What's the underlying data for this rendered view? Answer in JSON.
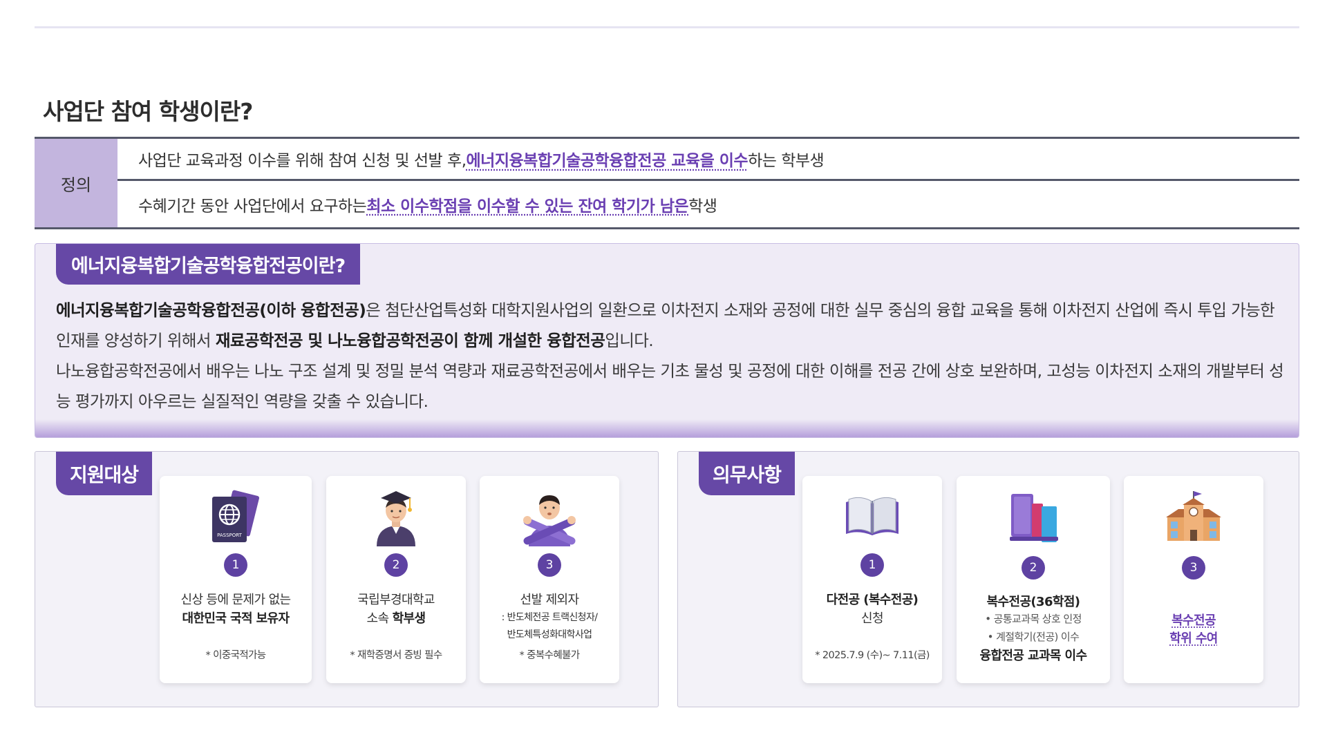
{
  "section_title": "사업단 참여 학생이란?",
  "definition": {
    "label": "정의",
    "row1": {
      "pre": "사업단 교육과정 이수를 위해 참여 신청 및 선발 후, ",
      "highlight": "에너지융복합기술공학융합전공 교육을 이수",
      "post": "하는 학부생"
    },
    "row2": {
      "pre": "수혜기간 동안 사업단에서 요구하는 ",
      "highlight": "최소 이수학점을 이수할 수 있는 잔여 학기가 남은",
      "post": " 학생"
    }
  },
  "about": {
    "tag": "에너지융복합기술공학융합전공이란?",
    "p1_bold": "에너지융복합기술공학융합전공(이하 융합전공)",
    "p1_text": "은 첨단산업특성화 대학지원사업의 일환으로 이차전지 소재와 공정에 대한 실무 중심의 융합 교육을 통해 이차전지 산업에 즉시 투입 가능한 인재를 양성하기 위해서 ",
    "p1_bold2": "재료공학전공 및 나노융합공학전공이 함께 개설한 융합전공",
    "p1_end": "입니다.",
    "p2": "나노융합공학전공에서 배우는 나노 구조 설계 및 정밀 분석 역량과 재료공학전공에서 배우는 기초 물성 및 공정에 대한 이해를 전공 간에 상호 보완하며, 고성능 이차전지 소재의 개발부터 성능 평가까지 아우르는 실질적인 역량을 갖출 수 있습니다."
  },
  "support": {
    "tag": "지원대상",
    "cards": [
      {
        "num": "1",
        "icon": "passport-icon",
        "line1": "신상 등에 문제가 없는",
        "line2": "대한민국 국적 보유자",
        "note": "* 이중국적가능"
      },
      {
        "num": "2",
        "icon": "student-graduate-icon",
        "line1": "국립부경대학교",
        "line2_pre": "소속 ",
        "line2_bold": "학부생",
        "note": "* 재학증명서 증빙 필수"
      },
      {
        "num": "3",
        "icon": "person-crossing-arms-icon",
        "line1": "선발 제외자",
        "sub1": ": 반도체전공 트랙신청자/",
        "sub2": "반도체특성화대학사업",
        "note": "* 중복수혜불가"
      }
    ]
  },
  "duty": {
    "tag": "의무사항",
    "cards": [
      {
        "num": "1",
        "icon": "open-book-icon",
        "line1": "다전공 (복수전공)",
        "line2": "신청",
        "note": "* 2025.7.9 (수)~ 7.11(금)"
      },
      {
        "num": "2",
        "icon": "books-icon",
        "line1": "복수전공(36학점)",
        "bullet1": "공통교과목 상호 인정",
        "bullet2": "계절학기(전공) 이수",
        "line_end": "융합전공 교과목 이수"
      },
      {
        "num": "3",
        "icon": "school-building-icon",
        "line1": "복수전공",
        "line2": "학위 수여"
      }
    ]
  },
  "passport_label": "PASSPORT"
}
